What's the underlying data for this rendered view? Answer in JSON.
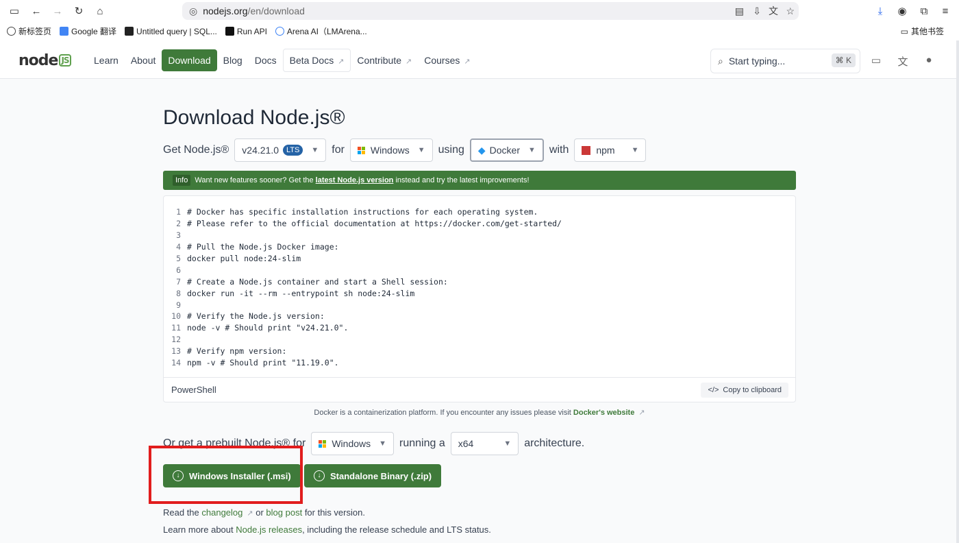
{
  "browser": {
    "url_host": "nodejs.org",
    "url_path": "/en/download",
    "bookmarks": [
      {
        "label": "新标签页",
        "color": "#444444"
      },
      {
        "label": "Google 翻译",
        "color": "#4285f4"
      },
      {
        "label": "Untitled query | SQL...",
        "color": "#222222"
      },
      {
        "label": "Run API",
        "color": "#111111"
      },
      {
        "label": "Arena AI（LMArena...",
        "color": "#3b82f6"
      }
    ],
    "other_bookmarks": "其他书签"
  },
  "header": {
    "nav": [
      {
        "label": "Learn"
      },
      {
        "label": "About"
      },
      {
        "label": "Download"
      },
      {
        "label": "Blog"
      },
      {
        "label": "Docs"
      },
      {
        "label": "Beta Docs",
        "arrow": "↗"
      },
      {
        "label": "Contribute",
        "arrow": "↗"
      },
      {
        "label": "Courses",
        "arrow": "↗"
      }
    ],
    "search_placeholder": "Start typing...",
    "search_shortcut": "⌘ K"
  },
  "page": {
    "title": "Download Node.js®",
    "get_label": "Get Node.js®",
    "version": "v24.21.0",
    "lts": "LTS",
    "for": "for",
    "os": "Windows",
    "using": "using",
    "method": "Docker",
    "with": "with",
    "pm": "npm",
    "info_tag": "Info",
    "info_pre": "Want new features sooner? Get the",
    "info_link": "latest Node.js version",
    "info_post": "instead and try the latest improvements!",
    "code_lines": [
      {
        "n": "1",
        "text": "# Docker has specific installation instructions for each operating system."
      },
      {
        "n": "2",
        "text": "# Please refer to the official documentation at https://docker.com/get-started/"
      },
      {
        "n": "3",
        "text": ""
      },
      {
        "n": "4",
        "text": "# Pull the Node.js Docker image:"
      },
      {
        "n": "5",
        "text": "docker pull node:24-slim"
      },
      {
        "n": "6",
        "text": ""
      },
      {
        "n": "7",
        "text": "# Create a Node.js container and start a Shell session:"
      },
      {
        "n": "8",
        "text": "docker run -it --rm --entrypoint sh node:24-slim"
      },
      {
        "n": "9",
        "text": ""
      },
      {
        "n": "10",
        "text": "# Verify the Node.js version:"
      },
      {
        "n": "11",
        "text": "node -v # Should print \"v24.21.0\"."
      },
      {
        "n": "12",
        "text": ""
      },
      {
        "n": "13",
        "text": "# Verify npm version:"
      },
      {
        "n": "14",
        "text": "npm -v # Should print \"11.19.0\"."
      }
    ],
    "shell": "PowerShell",
    "copy": "Copy to clipboard",
    "docker_note": "Docker is a containerization platform. If you encounter any issues please visit",
    "docker_link": "Docker's website",
    "prebuilt_pre": "Or get a prebuilt Node.js® for",
    "prebuilt_os": "Windows",
    "running_a": "running a",
    "arch": "x64",
    "architecture": "architecture.",
    "btn_msi": "Windows Installer (.msi)",
    "btn_zip": "Standalone Binary (.zip)",
    "read_the": "Read the",
    "changelog": "changelog",
    "or": "or",
    "blog_post": "blog post",
    "for_this": "for this version.",
    "learn_pre": "Learn more about",
    "releases": "Node.js releases",
    "learn_post": ", including the release schedule and LTS status."
  }
}
